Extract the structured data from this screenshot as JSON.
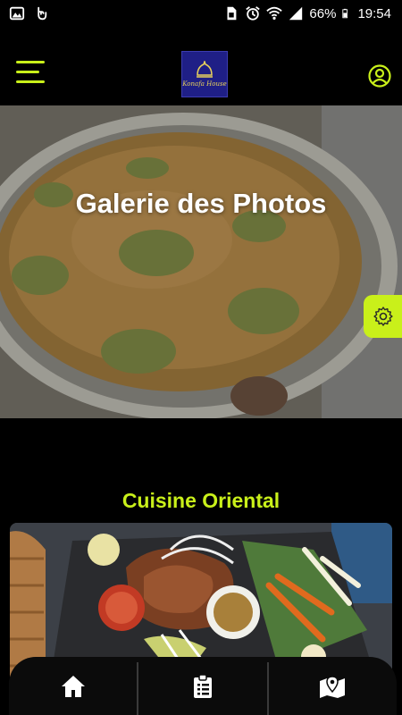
{
  "status_bar": {
    "battery": "66%",
    "time": "19:54"
  },
  "header": {
    "logo_text": "Konafa House"
  },
  "hero": {
    "title": "Galerie des Photos"
  },
  "section": {
    "title": "Cuisine Oriental"
  },
  "nav": {
    "items": [
      "home-icon",
      "clipboard-list-icon",
      "map-marker-icon"
    ]
  },
  "colors": {
    "accent": "#c9f01a",
    "background": "#000000",
    "logo_bg": "#1f1f86"
  }
}
